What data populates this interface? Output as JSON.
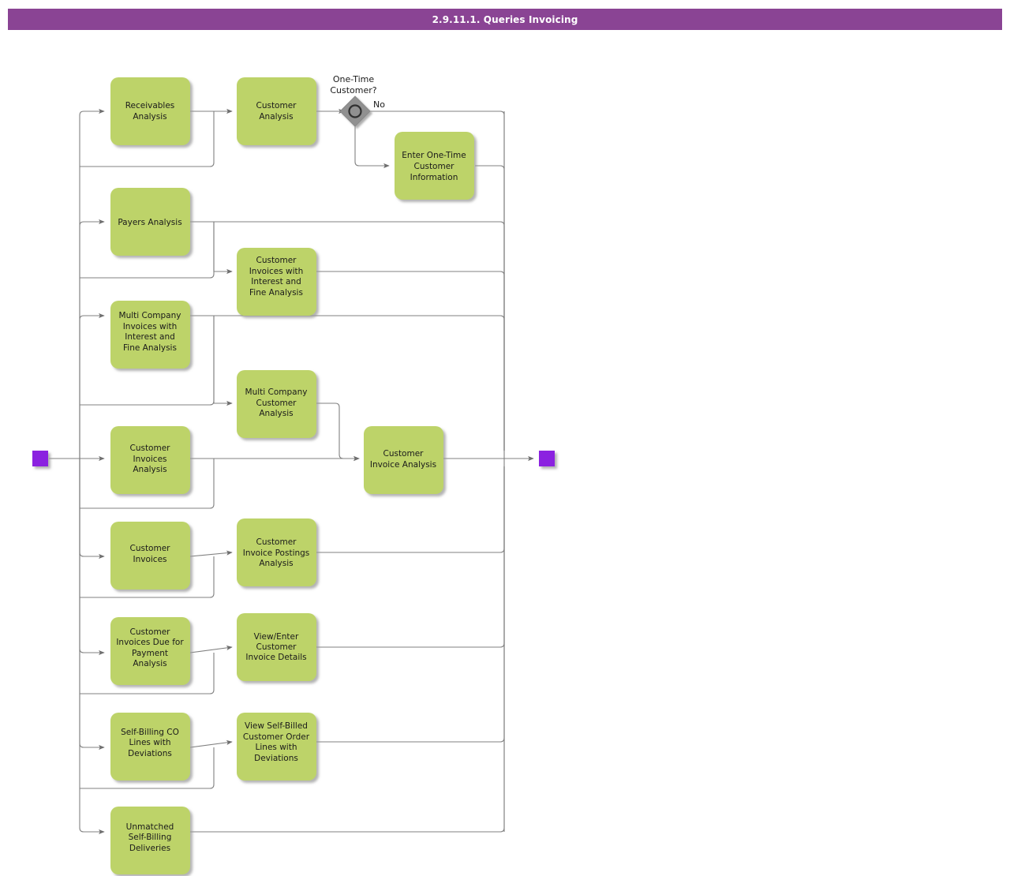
{
  "header": {
    "title": "2.9.11.1. Queries Invoicing"
  },
  "colors": {
    "header_bg": "#8a4494",
    "header_text": "#ffffff",
    "task_fill": "#bdd369",
    "task_text": "#1a1a1a",
    "connector": "#808080",
    "terminator": "#8b20e0",
    "gateway_fill": "#808080",
    "gateway_ring": "#333333"
  },
  "diagram": {
    "type": "process-flow",
    "start_node": {
      "name": "start-event",
      "shape": "square",
      "color": "#8b20e0"
    },
    "end_node": {
      "name": "end-event",
      "shape": "square",
      "color": "#8b20e0"
    },
    "gateway": {
      "name": "one-time-customer-gateway",
      "label": "One-Time\nCustomer?",
      "label_line1": "One-Time",
      "label_line2": "Customer?",
      "branch_label": "No"
    },
    "tasks": [
      {
        "id": "receivables-analysis",
        "lines": [
          "Receivables",
          "Analysis"
        ]
      },
      {
        "id": "customer-analysis",
        "lines": [
          "Customer",
          "Analysis"
        ]
      },
      {
        "id": "enter-one-time-customer-information",
        "lines": [
          "Enter One-Time",
          "Customer",
          "Information"
        ]
      },
      {
        "id": "payers-analysis",
        "lines": [
          "Payers Analysis"
        ]
      },
      {
        "id": "customer-invoices-with-interest-and-fine-analysis",
        "lines": [
          "Customer",
          "Invoices with",
          "Interest and",
          "Fine Analysis"
        ]
      },
      {
        "id": "multi-company-invoices-with-interest-and-fine-analysis",
        "lines": [
          "Multi Company",
          "Invoices with",
          "Interest and",
          "Fine Analysis"
        ]
      },
      {
        "id": "multi-company-customer-analysis",
        "lines": [
          "Multi Company",
          "Customer",
          "Analysis"
        ]
      },
      {
        "id": "customer-invoices-analysis",
        "lines": [
          "Customer",
          "Invoices",
          "Analysis"
        ]
      },
      {
        "id": "customer-invoice-analysis",
        "lines": [
          "Customer",
          "Invoice Analysis"
        ]
      },
      {
        "id": "customer-invoices",
        "lines": [
          "Customer",
          "Invoices"
        ]
      },
      {
        "id": "customer-invoice-postings-analysis",
        "lines": [
          "Customer",
          "Invoice Postings",
          "Analysis"
        ]
      },
      {
        "id": "customer-invoices-due-for-payment-analysis",
        "lines": [
          "Customer",
          "Invoices Due for",
          "Payment",
          "Analysis"
        ]
      },
      {
        "id": "view-enter-customer-invoice-details",
        "lines": [
          "View/Enter",
          "Customer",
          "Invoice Details"
        ]
      },
      {
        "id": "self-billing-co-lines-with-deviations",
        "lines": [
          "Self-Billing CO",
          "Lines with",
          "Deviations"
        ]
      },
      {
        "id": "view-self-billed-customer-order-lines-with-deviations",
        "lines": [
          "View Self-Billed",
          "Customer Order",
          "Lines with",
          "Deviations"
        ]
      },
      {
        "id": "unmatched-self-billing-deliveries",
        "lines": [
          "Unmatched",
          "Self-Billing",
          "Deliveries"
        ]
      }
    ]
  }
}
